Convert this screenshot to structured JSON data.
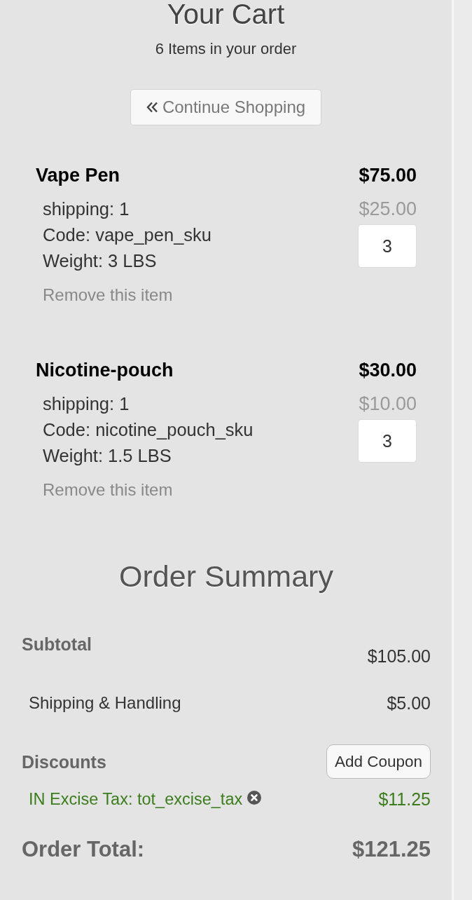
{
  "header": {
    "title": "Your Cart",
    "subtitle": "6 Items in your order",
    "continue_button": "Continue Shopping"
  },
  "items": [
    {
      "name": "Vape Pen",
      "price": "$75.00",
      "details": [
        "shipping: 1",
        "Code: vape_pen_sku",
        "Weight: 3 LBS"
      ],
      "unit_price": "$25.00",
      "quantity": "3",
      "remove_link": "Remove this item"
    },
    {
      "name": "Nicotine-pouch",
      "price": "$30.00",
      "details": [
        "shipping: 1",
        "Code: nicotine_pouch_sku",
        "Weight: 1.5 LBS"
      ],
      "unit_price": "$10.00",
      "quantity": "3",
      "remove_link": "Remove this item"
    }
  ],
  "summary": {
    "title": "Order Summary",
    "subtotal": {
      "label": "Subtotal",
      "value": "$105.00"
    },
    "shipping": {
      "label": "Shipping & Handling",
      "value": "$5.00"
    },
    "discounts": {
      "label": "Discounts",
      "button": "Add Coupon",
      "lines": [
        {
          "label": "IN Excise Tax: tot_excise_tax",
          "value": "$11.25"
        }
      ]
    },
    "total": {
      "label": "Order Total:",
      "value": "$121.25"
    }
  }
}
